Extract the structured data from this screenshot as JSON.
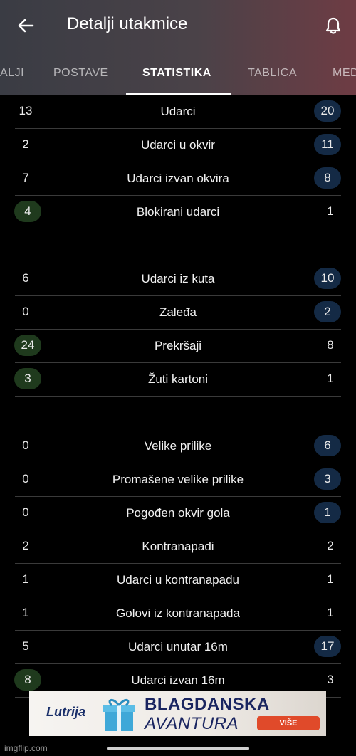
{
  "app": {
    "title": "Detalji utakmice",
    "back_icon": "arrow-left-icon",
    "bell_icon": "bell-icon"
  },
  "tabs": [
    {
      "label": "ALJI",
      "active": false
    },
    {
      "label": "POSTAVE",
      "active": false
    },
    {
      "label": "STATISTIKA",
      "active": true
    },
    {
      "label": "TABLICA",
      "active": false
    },
    {
      "label": "MED",
      "active": false
    }
  ],
  "stats_groups": [
    [
      {
        "label": "Udarci",
        "left": "13",
        "right": "20",
        "leader": "right"
      },
      {
        "label": "Udarci u okvir",
        "left": "2",
        "right": "11",
        "leader": "right"
      },
      {
        "label": "Udarci izvan okvira",
        "left": "7",
        "right": "8",
        "leader": "right"
      },
      {
        "label": "Blokirani udarci",
        "left": "4",
        "right": "1",
        "leader": "left"
      }
    ],
    [
      {
        "label": "Udarci iz kuta",
        "left": "6",
        "right": "10",
        "leader": "right"
      },
      {
        "label": "Zaleđa",
        "left": "0",
        "right": "2",
        "leader": "right"
      },
      {
        "label": "Prekršaji",
        "left": "24",
        "right": "8",
        "leader": "left"
      },
      {
        "label": "Žuti kartoni",
        "left": "3",
        "right": "1",
        "leader": "left"
      }
    ],
    [
      {
        "label": "Velike prilike",
        "left": "0",
        "right": "6",
        "leader": "right"
      },
      {
        "label": "Promašene velike prilike",
        "left": "0",
        "right": "3",
        "leader": "right"
      },
      {
        "label": "Pogođen okvir gola",
        "left": "0",
        "right": "1",
        "leader": "right"
      },
      {
        "label": "Kontranapadi",
        "left": "2",
        "right": "2",
        "leader": "none"
      },
      {
        "label": "Udarci u kontranapadu",
        "left": "1",
        "right": "1",
        "leader": "none"
      },
      {
        "label": "Golovi iz kontranapada",
        "left": "1",
        "right": "1",
        "leader": "none"
      },
      {
        "label": "Udarci unutar 16m",
        "left": "5",
        "right": "17",
        "leader": "right"
      },
      {
        "label": "Udarci izvan 16m",
        "left": "8",
        "right": "3",
        "leader": "left"
      }
    ]
  ],
  "colors": {
    "left_leader_pill": "#1f3a1d",
    "right_leader_pill": "#142a45",
    "divider": "#3a3a3a"
  },
  "ad": {
    "brand": "Lutrija",
    "headline1": "BLAGDANSKA",
    "headline2": "AVANTURA",
    "cta": "VIŠE"
  },
  "watermark": "imgflip.com"
}
